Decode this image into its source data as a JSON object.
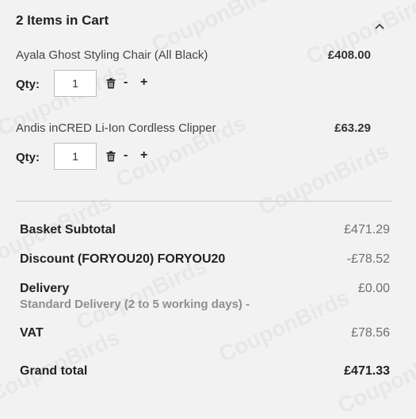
{
  "cart": {
    "title": "2 Items in Cart",
    "qty_label": "Qty:",
    "minus_label": "-",
    "plus_label": "+",
    "items": [
      {
        "name": "Ayala Ghost Styling Chair (All Black)",
        "price": "£408.00",
        "qty": "1"
      },
      {
        "name": "Andis inCRED Li-Ion Cordless Clipper",
        "price": "£63.29",
        "qty": "1"
      }
    ]
  },
  "summary": {
    "subtotal_label": "Basket Subtotal",
    "subtotal_value": "£471.29",
    "discount_label": "Discount (FORYOU20) FORYOU20",
    "discount_value": "-£78.52",
    "delivery_label": "Delivery",
    "delivery_sub": "Standard Delivery (2 to 5 working days) -",
    "delivery_value": "£0.00",
    "vat_label": "VAT",
    "vat_value": "£78.56",
    "grand_total_label": "Grand total",
    "grand_total_value": "£471.33"
  },
  "watermark": "CouponBirds",
  "icons": {
    "collapse": "chevron-up-icon",
    "remove": "trash-icon"
  }
}
